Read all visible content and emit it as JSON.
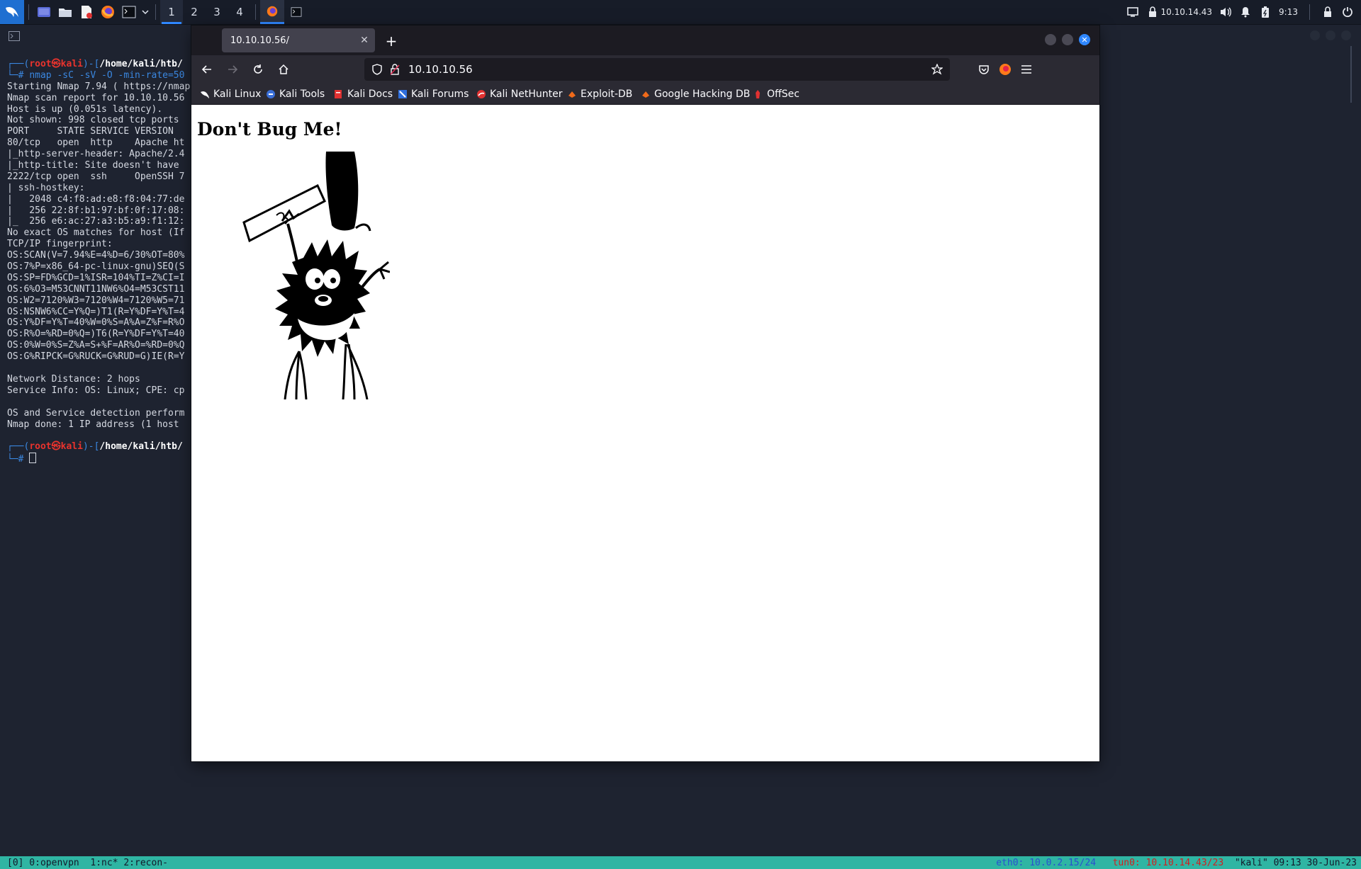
{
  "panel": {
    "workspaces": [
      "1",
      "2",
      "3",
      "4"
    ],
    "active_workspace": "1",
    "ip_address": "10.10.14.43",
    "clock": "9:13",
    "icons": [
      "kali-menu-icon",
      "desktop-icon",
      "file-manager-icon",
      "text-editor-icon",
      "firefox-icon",
      "terminal-icon",
      "chevron-down-icon",
      "screen-icon",
      "vpn-lock-icon",
      "volume-icon",
      "bell-icon",
      "battery-icon",
      "lock-icon",
      "power-icon"
    ]
  },
  "terminal": {
    "lines": [
      {
        "type": "prompt",
        "frame": "┌──(",
        "user": "root㉿kali",
        "mid": ")-[",
        "path": "/home/kali/htb/"
      },
      {
        "type": "command",
        "prefix": "└─# ",
        "text": "nmap -sC -sV -O -min-rate=50"
      },
      {
        "type": "text",
        "text": "Starting Nmap 7.94 ( https://nmap"
      },
      {
        "type": "text",
        "text": "Nmap scan report for 10.10.10.56"
      },
      {
        "type": "text",
        "text": "Host is up (0.051s latency)."
      },
      {
        "type": "text",
        "text": "Not shown: 998 closed tcp ports"
      },
      {
        "type": "text",
        "text": "PORT     STATE SERVICE VERSION"
      },
      {
        "type": "text",
        "text": "80/tcp   open  http    Apache ht"
      },
      {
        "type": "text",
        "text": "|_http-server-header: Apache/2.4"
      },
      {
        "type": "text",
        "text": "|_http-title: Site doesn't have"
      },
      {
        "type": "text",
        "text": "2222/tcp open  ssh     OpenSSH 7"
      },
      {
        "type": "text",
        "text": "| ssh-hostkey:"
      },
      {
        "type": "text",
        "text": "|   2048 c4:f8:ad:e8:f8:04:77:de"
      },
      {
        "type": "text",
        "text": "|   256 22:8f:b1:97:bf:0f:17:08:"
      },
      {
        "type": "text",
        "text": "|_  256 e6:ac:27:a3:b5:a9:f1:12:"
      },
      {
        "type": "text",
        "text": "No exact OS matches for host (If"
      },
      {
        "type": "text",
        "text": "TCP/IP fingerprint:"
      },
      {
        "type": "text",
        "text": "OS:SCAN(V=7.94%E=4%D=6/30%OT=80%"
      },
      {
        "type": "text",
        "text": "OS:7%P=x86_64-pc-linux-gnu)SEQ(S"
      },
      {
        "type": "text",
        "text": "OS:SP=FD%GCD=1%ISR=104%TI=Z%CI=I"
      },
      {
        "type": "text",
        "text": "OS:6%O3=M53CNNT11NW6%O4=M53CST11"
      },
      {
        "type": "text",
        "text": "OS:W2=7120%W3=7120%W4=7120%W5=71"
      },
      {
        "type": "text",
        "text": "OS:NSNW6%CC=Y%Q=)T1(R=Y%DF=Y%T=4"
      },
      {
        "type": "text",
        "text": "OS:Y%DF=Y%T=40%W=0%S=A%A=Z%F=R%O"
      },
      {
        "type": "text",
        "text": "OS:R%O=%RD=0%Q=)T6(R=Y%DF=Y%T=40"
      },
      {
        "type": "text",
        "text": "OS:0%W=0%S=Z%A=S+%F=AR%O=%RD=0%Q"
      },
      {
        "type": "text",
        "text": "OS:G%RIPCK=G%RUCK=G%RUD=G)IE(R=Y"
      },
      {
        "type": "text",
        "text": ""
      },
      {
        "type": "text",
        "text": "Network Distance: 2 hops"
      },
      {
        "type": "text",
        "text": "Service Info: OS: Linux; CPE: cp"
      },
      {
        "type": "text",
        "text": ""
      },
      {
        "type": "text",
        "text": "OS and Service detection perform"
      },
      {
        "type": "text",
        "text": "Nmap done: 1 IP address (1 host"
      },
      {
        "type": "text",
        "text": ""
      },
      {
        "type": "prompt",
        "frame": "┌──(",
        "user": "root㉿kali",
        "mid": ")-[",
        "path": "/home/kali/htb/"
      },
      {
        "type": "cursor",
        "prefix": "└─# "
      }
    ]
  },
  "tmux": {
    "left": "[0] 0:openvpn  1:nc* 2:recon-",
    "eth": "eth0: 10.0.2.15/24",
    "tun": "tun0: 10.10.14.43/23",
    "host": "\"kali\" 09:13 30-Jun-23"
  },
  "browser": {
    "tab_title": "10.10.10.56/",
    "url": "10.10.10.56",
    "bookmarks": [
      {
        "label": "Kali Linux",
        "icon": "kali-dragon-icon"
      },
      {
        "label": "Kali Tools",
        "icon": "kali-tools-icon"
      },
      {
        "label": "Kali Docs",
        "icon": "kali-docs-icon"
      },
      {
        "label": "Kali Forums",
        "icon": "kali-forums-icon"
      },
      {
        "label": "Kali NetHunter",
        "icon": "nethunter-icon"
      },
      {
        "label": "Exploit-DB",
        "icon": "exploit-db-icon"
      },
      {
        "label": "Google Hacking DB",
        "icon": "ghdb-icon"
      },
      {
        "label": "OffSec",
        "icon": "offsec-icon"
      }
    ],
    "page": {
      "heading": "Don't Bug Me!",
      "image": "bug-with-hammer-image"
    }
  },
  "colors": {
    "accent": "#2f87ff",
    "prompt_frame": "#3a87e0",
    "prompt_root": "#e8332d",
    "tmux_bar": "#2fb5a3"
  }
}
